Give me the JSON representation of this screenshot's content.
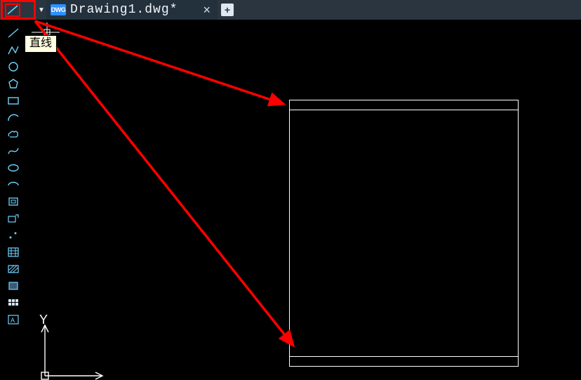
{
  "tabbar": {
    "active_tab_label": "Drawing1.dwg*",
    "dwg_badge_text": "DWG",
    "dropdown_glyph": "▼",
    "close_glyph": "×",
    "newtab_glyph": "+"
  },
  "tooltip": {
    "line_tool": "直线"
  },
  "axis": {
    "y_label": "Y"
  },
  "tools": [
    {
      "name": "line-tool"
    },
    {
      "name": "polyline-tool"
    },
    {
      "name": "circle-tool"
    },
    {
      "name": "polygon-tool"
    },
    {
      "name": "rectangle-tool"
    },
    {
      "name": "arc-tool"
    },
    {
      "name": "revcloud-tool"
    },
    {
      "name": "spline-tool"
    },
    {
      "name": "ellipse-tool"
    },
    {
      "name": "ellipse-arc-tool"
    },
    {
      "name": "block-tool"
    },
    {
      "name": "insert-tool"
    },
    {
      "name": "point-tool"
    },
    {
      "name": "hatch-tool"
    },
    {
      "name": "gradient-tool"
    },
    {
      "name": "region-tool"
    },
    {
      "name": "table-tool"
    },
    {
      "name": "text-tool"
    }
  ],
  "colors": {
    "icon": "#6fd3ff",
    "highlight": "#ff0000",
    "tooltip_bg": "#ffffe1",
    "canvas_bg": "#000000",
    "draft_line": "#ffffff",
    "tabbar_bg": "#2a3540"
  }
}
